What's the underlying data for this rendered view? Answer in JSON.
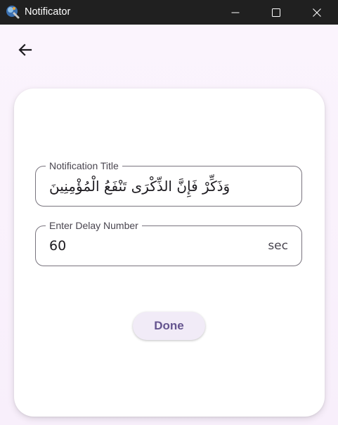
{
  "window": {
    "title": "Notificator",
    "controls": {
      "minimize": "minimize-icon",
      "maximize": "maximize-icon",
      "close": "close-icon"
    }
  },
  "colors": {
    "titlebar": "#202020",
    "background": "#fdf7ff",
    "card": "#ffffff",
    "outline": "#79747e",
    "primary": "#65558f",
    "button_bg": "#f1ebf7"
  },
  "nav": {
    "back_icon": "arrow-left-icon"
  },
  "form": {
    "notification_title": {
      "label": "Notification Title",
      "value": "وَذَكِّرْ فَإِنَّ الذِّكْرَى تَنْفَعُ الْمُؤْمِنِينَ"
    },
    "delay": {
      "label": "Enter Delay Number",
      "value": "60",
      "suffix": "sec"
    },
    "done_label": "Done"
  }
}
